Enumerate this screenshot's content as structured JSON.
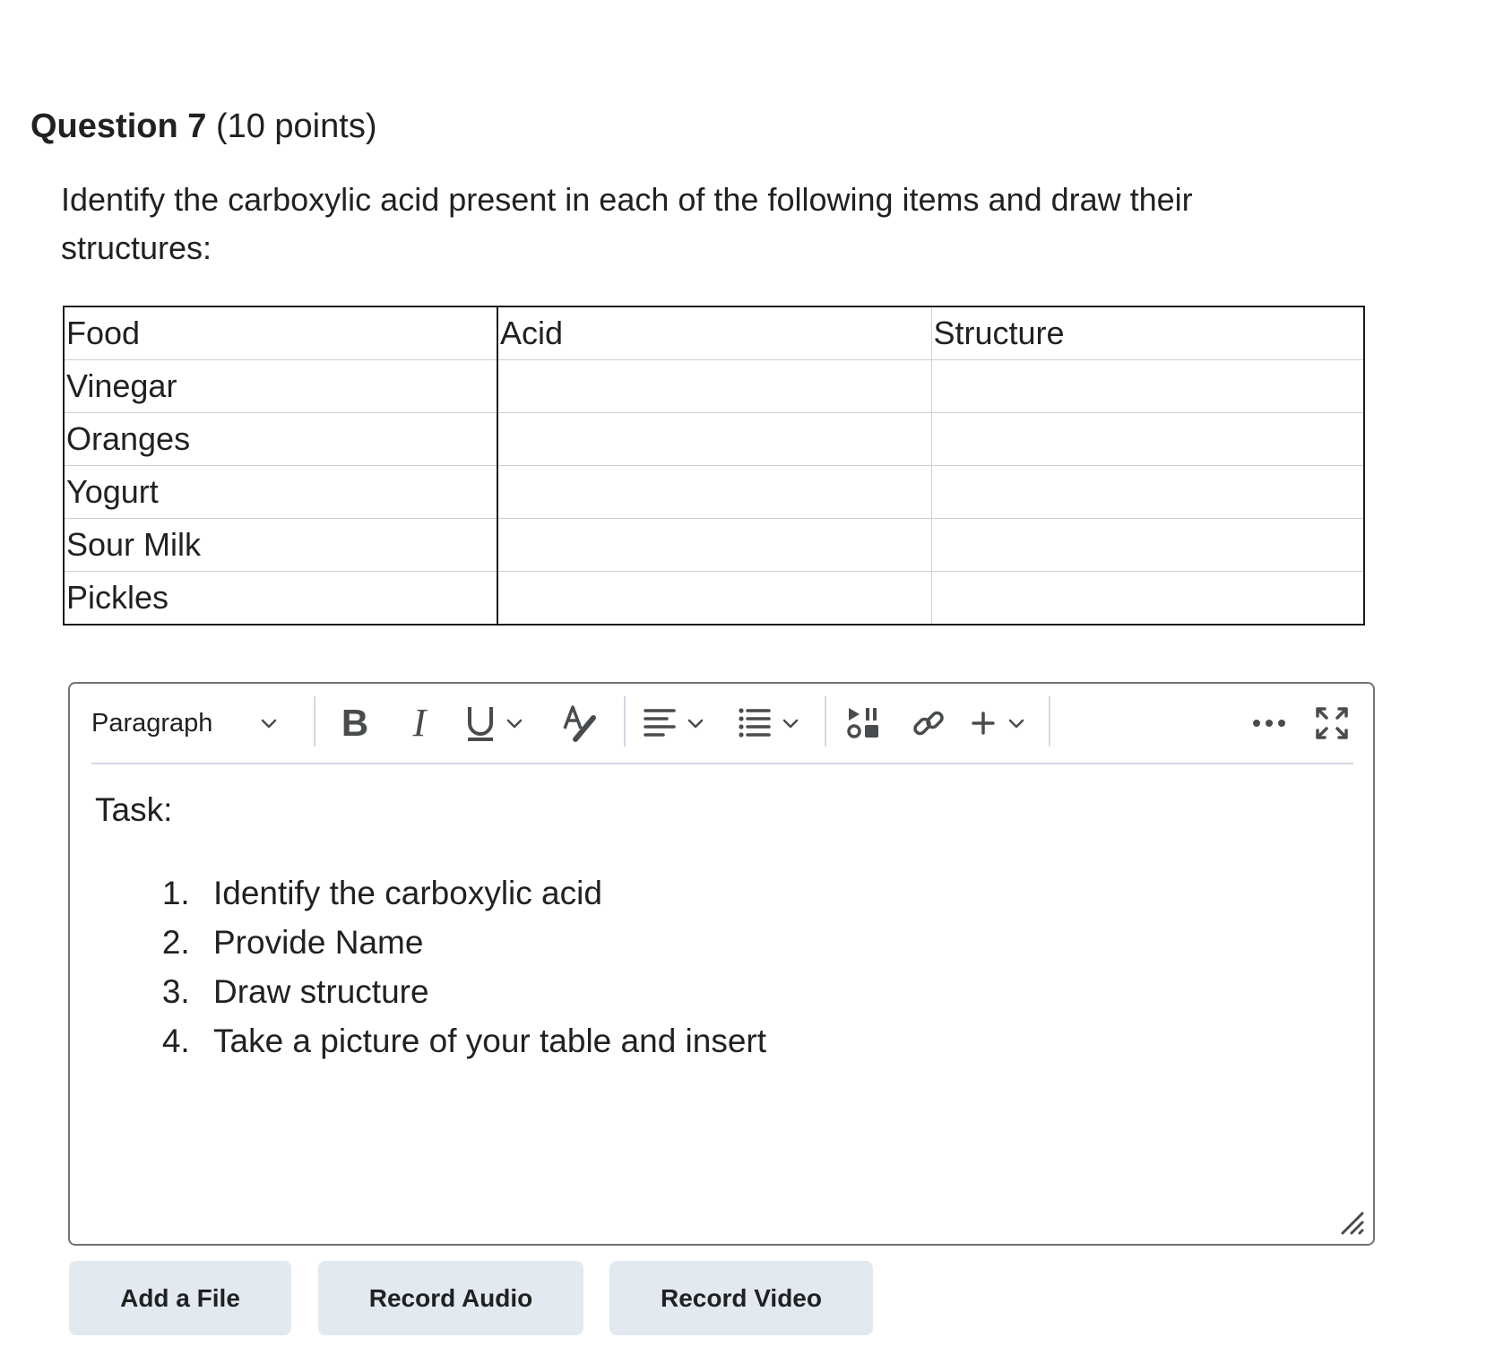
{
  "question": {
    "title": "Question 7",
    "points": "(10 points)",
    "prompt": "Identify the carboxylic acid present in each of the following items and draw their structures:"
  },
  "table": {
    "headers": [
      "Food",
      "Acid",
      "Structure"
    ],
    "rows": [
      [
        "Vinegar",
        "",
        ""
      ],
      [
        "Oranges",
        "",
        ""
      ],
      [
        "Yogurt",
        "",
        ""
      ],
      [
        "Sour Milk",
        "",
        ""
      ],
      [
        "Pickles",
        "",
        ""
      ]
    ]
  },
  "editor": {
    "toolbar": {
      "format_select": "Paragraph",
      "icons": [
        "bold-icon",
        "italic-icon",
        "underline-icon",
        "chevron-down-icon",
        "text-style-icon",
        "align-left-icon",
        "list-icon",
        "media-icon",
        "link-icon",
        "plus-icon",
        "more-icon",
        "fullscreen-icon"
      ]
    },
    "content": {
      "task_label": "Task:",
      "task_items": [
        "Identify the carboxylic acid",
        "Provide Name",
        "Draw structure",
        "Take a picture of your table and insert"
      ]
    }
  },
  "actions": {
    "add_file": "Add a File",
    "record_audio": "Record Audio",
    "record_video": "Record Video"
  },
  "colors": {
    "text": "#202122",
    "icon": "#494c4e",
    "editor_border": "#6e7477",
    "toolbar_divider": "#d3d9e3",
    "button_bg": "#e3e9f1"
  }
}
